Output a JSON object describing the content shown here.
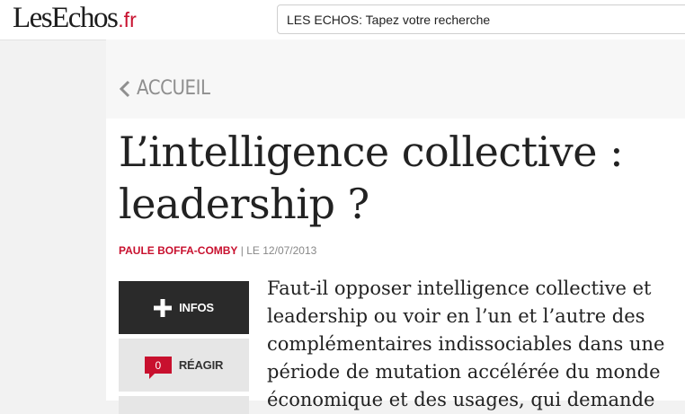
{
  "header": {
    "logo_text": "LesEchos",
    "logo_suffix": ".fr",
    "search_placeholder": "LES ECHOS: Tapez votre recherche"
  },
  "nav": {
    "back_label": "ACCUEIL",
    "back_icon": "chevron-left-icon"
  },
  "article": {
    "title_line1": "L’intelligence collective :",
    "title_line2": "leadership ?",
    "author": "PAULE BOFFA-COMBY",
    "date_text": "| LE 12/07/2013",
    "lead_lines": [
      "Faut-il opposer intelligence collective et",
      "leadership ou voir en l’un et l’autre des",
      "complémentaires indissociables dans une",
      "période de mutation accélérée du monde",
      "économique et des usages, qui demande"
    ]
  },
  "sidebar": {
    "infos_label": "INFOS",
    "infos_icon": "plus-icon",
    "reagir_label": "RÉAGIR",
    "reagir_count": "0",
    "reagir_icon": "comment-bubble-icon"
  },
  "colors": {
    "brand_red": "#c8102e",
    "dark_button": "#2a2a2a"
  }
}
